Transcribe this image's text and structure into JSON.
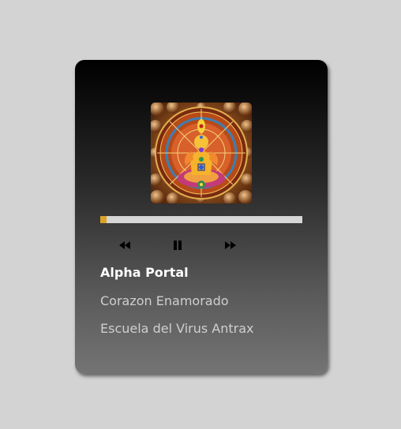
{
  "player": {
    "artwork_icon": "meditation-mandala-artwork",
    "progress_fraction": 0.03,
    "progress_color": "#d9a32a",
    "track_color": "#d6d6d6",
    "controls": {
      "previous_icon": "rewind-icon",
      "play_pause_icon": "pause-icon",
      "next_icon": "fast-forward-icon"
    },
    "track_title": "Alpha Portal",
    "artist": "Corazon Enamorado",
    "album": "Escuela del Virus Antrax"
  }
}
